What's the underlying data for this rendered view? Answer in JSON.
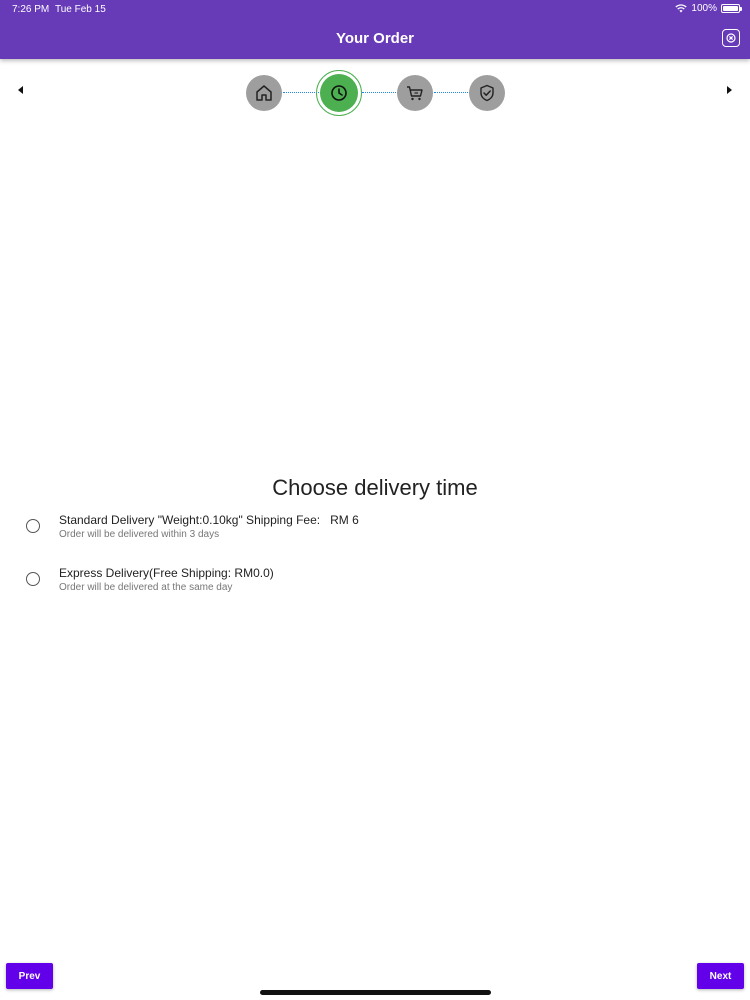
{
  "status_bar": {
    "time": "7:26 PM",
    "date": "Tue Feb 15",
    "battery": "100%"
  },
  "header": {
    "title": "Your Order",
    "background": "#673ab7"
  },
  "stepper": {
    "active_step": 2,
    "steps": [
      {
        "icon": "home-icon"
      },
      {
        "icon": "clock-icon"
      },
      {
        "icon": "cart-icon"
      },
      {
        "icon": "shield-check-icon"
      }
    ],
    "active_color": "#4caf50",
    "inactive_color": "#9e9e9e"
  },
  "main": {
    "title": "Choose delivery time",
    "options": [
      {
        "label": "Standard Delivery \"Weight:0.10kg\" Shipping Fee:   RM 6",
        "sublabel": "Order will be delivered within 3 days",
        "selected": false
      },
      {
        "label": "Express Delivery(Free Shipping: RM0.0)",
        "sublabel": "Order will be delivered at the same day",
        "selected": false
      }
    ]
  },
  "footer": {
    "prev_label": "Prev",
    "next_label": "Next",
    "button_color": "#6200ea"
  }
}
